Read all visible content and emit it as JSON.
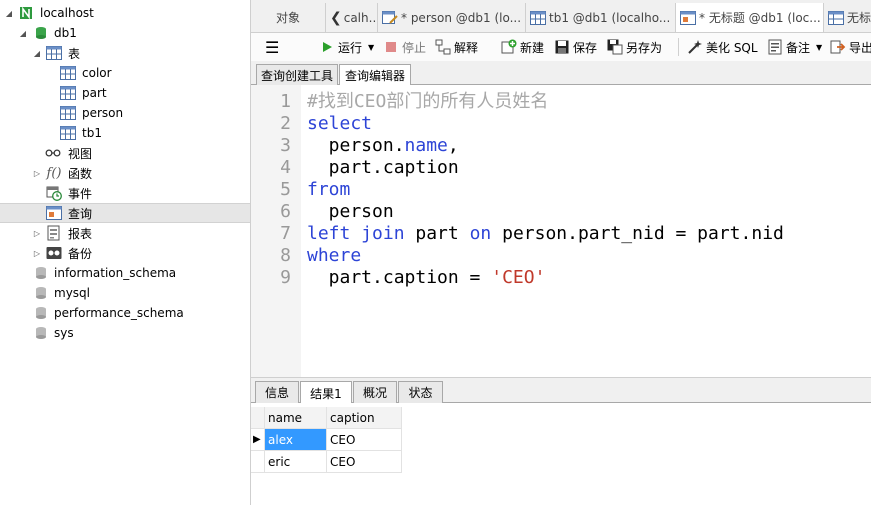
{
  "sidebar": {
    "connection": "localhost",
    "database": "db1",
    "tables_folder": "表",
    "tables": [
      "color",
      "part",
      "person",
      "tb1"
    ],
    "views": "视图",
    "functions": "函数",
    "events": "事件",
    "queries": "查询",
    "reports": "报表",
    "backups": "备份",
    "other_databases": [
      "information_schema",
      "mysql",
      "performance_schema",
      "sys"
    ]
  },
  "tabs": {
    "objects": "对象",
    "items": [
      "calh...",
      "* person @db1 (lo...",
      "tb1 @db1 (localho...",
      "* 无标题 @db1 (loc...",
      "无标"
    ]
  },
  "toolbar": {
    "run": "运行",
    "stop": "停止",
    "explain": "解释",
    "new": "新建",
    "save": "保存",
    "save_as": "另存为",
    "beautify": "美化 SQL",
    "comment": "备注",
    "export": "导出"
  },
  "subtabs": {
    "builder": "查询创建工具",
    "editor": "查询编辑器"
  },
  "editor": {
    "line_numbers": [
      "1",
      "2",
      "3",
      "4",
      "5",
      "6",
      "7",
      "8",
      "9"
    ],
    "l1": "#找到CEO部门的所有人员姓名",
    "l2": "select",
    "l3a": "  person.",
    "l3b": "name",
    "l3c": ",",
    "l4": "  part.caption",
    "l5": "from",
    "l6": "  person",
    "l7a": "left join",
    "l7b": " part ",
    "l7c": "on",
    "l7d": " person.part_nid = part.nid",
    "l8": "where",
    "l9a": "  part.caption = ",
    "l9b": "'CEO'"
  },
  "result_tabs": [
    "信息",
    "结果1",
    "概况",
    "状态"
  ],
  "result": {
    "columns": [
      "name",
      "caption"
    ],
    "rows": [
      [
        "alex",
        "CEO"
      ],
      [
        "eric",
        "CEO"
      ]
    ]
  }
}
